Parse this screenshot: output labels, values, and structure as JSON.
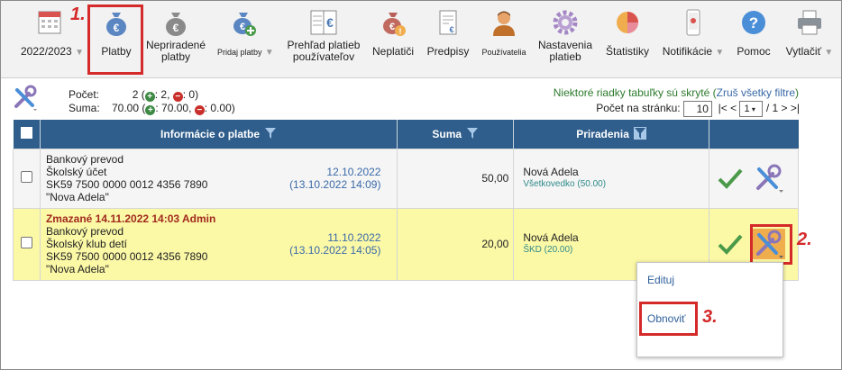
{
  "toolbar": {
    "year": "2022/2023",
    "items": [
      {
        "label": "Platby"
      },
      {
        "label": "Nepriradené platby"
      },
      {
        "label": "Pridaj platby"
      },
      {
        "label": "Prehľad platieb používateľov"
      },
      {
        "label": "Neplatiči"
      },
      {
        "label": "Predpisy"
      },
      {
        "label": "Používatelia"
      },
      {
        "label": "Nastavenia platieb"
      },
      {
        "label": "Štatistiky"
      },
      {
        "label": "Notifikácie"
      },
      {
        "label": "Pomoc"
      },
      {
        "label": "Vytlačiť"
      }
    ]
  },
  "steps": {
    "one": "1.",
    "two": "2.",
    "three": "3."
  },
  "summary": {
    "count_label": "Počet:",
    "count_value": "2",
    "count_plus": "2",
    "count_minus": "0",
    "sum_label": "Suma:",
    "sum_value": "70.00",
    "sum_plus": "70.00",
    "sum_minus": "0.00"
  },
  "notice": {
    "text": "Niektoré riadky tabuľky sú skryté",
    "link": "Zruš všetky filtre"
  },
  "pager": {
    "label": "Počet na stránku:",
    "per_page": "10",
    "first": "|<",
    "prev": "<",
    "page": "1",
    "of": "/ 1",
    "next": ">",
    "last": ">|"
  },
  "table": {
    "headers": {
      "info": "Informácie o platbe",
      "amount": "Suma",
      "assign": "Priradenia"
    },
    "rows": [
      {
        "deleted": "",
        "lines": [
          "Bankový prevod",
          "Školský účet",
          "SK59 7500 0000 0012 4356 7890",
          "\"Nova Adela\""
        ],
        "date": "12.10.2022",
        "datetime": "(13.10.2022 14:09)",
        "amount": "50,00",
        "name": "Nová Adela",
        "sub": "Všetkovedko (50.00)"
      },
      {
        "deleted": "Zmazané 14.11.2022 14:03 Admin",
        "lines": [
          "Bankový prevod",
          "Školský klub detí",
          "SK59 7500 0000 0012 4356 7890",
          "\"Nova Adela\""
        ],
        "date": "11.10.2022",
        "datetime": "(13.10.2022 14:05)",
        "amount": "20,00",
        "name": "Nová Adela",
        "sub": "ŠKD (20.00)"
      }
    ]
  },
  "popup": {
    "edit": "Edituj",
    "restore": "Obnoviť"
  },
  "colors": {
    "header": "#2f5e8c",
    "highlight": "#d42a2a",
    "deleted_row": "#fbf8a6"
  }
}
